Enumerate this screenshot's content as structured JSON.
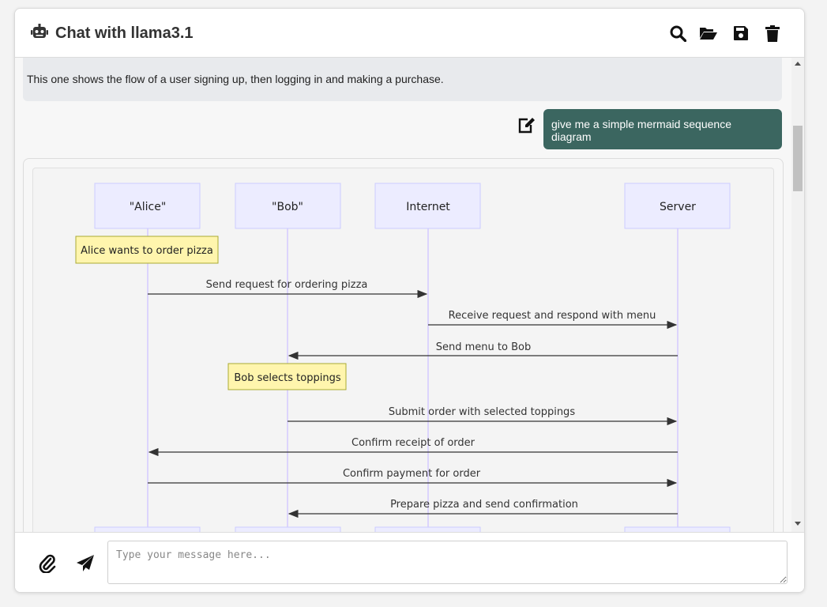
{
  "app": {
    "title": "Chat with llama3.1",
    "icon": "robot-icon"
  },
  "toolbar": {
    "search_icon": "search-icon",
    "open_icon": "folder-open-icon",
    "save_icon": "save-icon",
    "delete_icon": "trash-icon"
  },
  "messages": {
    "previous_assistant_text": "This one shows the flow of a user signing up, then logging in and making a purchase.",
    "user_text": "give me a simple mermaid sequence diagram",
    "edit_icon": "edit-icon"
  },
  "diagram": {
    "participants": [
      "\"Alice\"",
      "\"Bob\"",
      "Internet",
      "Server"
    ],
    "notes": [
      "Alice wants to order pizza",
      "Bob selects toppings"
    ],
    "messages": [
      "Send request for ordering pizza",
      "Receive request and respond with menu",
      "Send menu to Bob",
      "Submit order with selected toppings",
      "Confirm receipt of order",
      "Confirm payment for order",
      "Prepare pizza and send confirmation"
    ]
  },
  "composer": {
    "placeholder": "Type your message here...",
    "attach_icon": "paperclip-icon",
    "send_icon": "send-icon"
  },
  "colors": {
    "user_bubble": "#3b6660",
    "participant_fill": "#ececff",
    "participant_stroke": "#ccccff",
    "note_fill": "#fff5ad",
    "note_stroke": "#aaaa33"
  }
}
